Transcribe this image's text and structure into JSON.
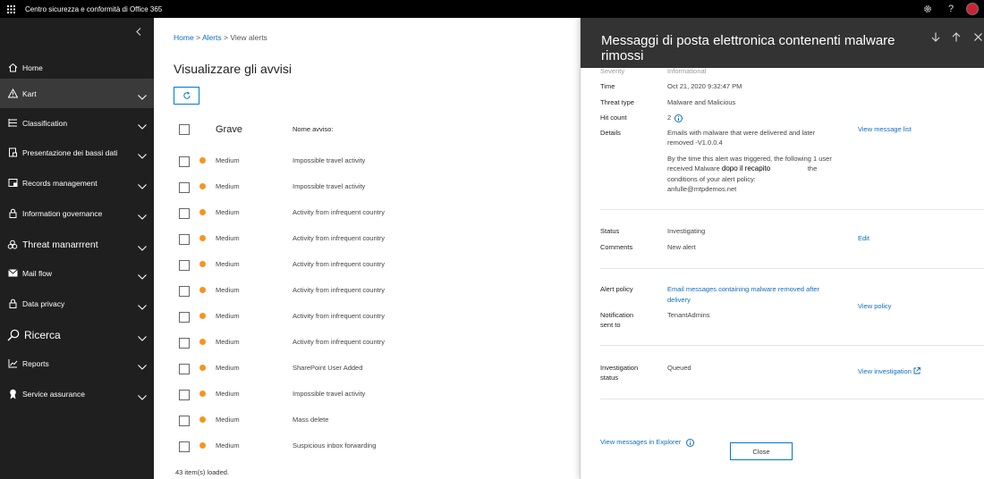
{
  "topbar": {
    "app_title": "Centro sicurezza e conformità di Office 365",
    "icons": [
      "waffle-icon",
      "settings-icon",
      "help-icon",
      "avatar"
    ],
    "help_glyph": "?"
  },
  "sidebar": {
    "items": [
      {
        "label": "Home",
        "icon": "home-icon",
        "chevron": false
      },
      {
        "label": "Kart",
        "icon": "alert-icon",
        "chevron": true,
        "active": true
      },
      {
        "label": "Classification",
        "icon": "classification-icon",
        "chevron": true
      },
      {
        "label": "Presentazione dei bassi dati",
        "icon": "data-loss-icon",
        "chevron": true
      },
      {
        "label": "Records management",
        "icon": "records-icon",
        "chevron": true
      },
      {
        "label": "Information governance",
        "icon": "lock-icon",
        "chevron": true
      },
      {
        "label": "Threat manarrrent",
        "icon": "biohazard-icon",
        "chevron": true
      },
      {
        "label": "Mail flow",
        "icon": "mail-icon",
        "chevron": true
      },
      {
        "label": "Data privacy",
        "icon": "lock-icon",
        "chevron": true
      },
      {
        "label": "Ricerca",
        "icon": "search-icon",
        "chevron": true
      },
      {
        "label": "Reports",
        "icon": "reports-icon",
        "chevron": true
      },
      {
        "label": "Service assurance",
        "icon": "ribbon-icon",
        "chevron": true
      }
    ]
  },
  "breadcrumb": {
    "home": "Home",
    "sep1": ">",
    "alerts": "Alerts",
    "sep2": ">",
    "current": "View alerts"
  },
  "page": {
    "title": "Visualizzare gli avvisi"
  },
  "table": {
    "header_severity": "Grave",
    "header_name": "Nome avviso:",
    "rows": [
      {
        "severity": "Medium",
        "name": "Impossible travel activity"
      },
      {
        "severity": "Medium",
        "name": "Impossible travel activity"
      },
      {
        "severity": "Medium",
        "name": "Activity from infrequent country"
      },
      {
        "severity": "Medium",
        "name": "Activity from infrequent country"
      },
      {
        "severity": "Medium",
        "name": "Activity from infrequent country"
      },
      {
        "severity": "Medium",
        "name": "Activity from infrequent country"
      },
      {
        "severity": "Medium",
        "name": "Activity from infrequent country"
      },
      {
        "severity": "Medium",
        "name": "Activity from infrequent country"
      },
      {
        "severity": "Medium",
        "name": "SharePoint User Added"
      },
      {
        "severity": "Medium",
        "name": "Impossible travel activity"
      },
      {
        "severity": "Medium",
        "name": "Mass delete"
      },
      {
        "severity": "Medium",
        "name": "Suspicious inbox forwarding"
      }
    ],
    "status": "43 item(s) loaded."
  },
  "panel": {
    "title": "Messaggi di posta elettronica contenenti malware rimossi",
    "partial_top": {
      "label": "Severity",
      "value": "Informational"
    },
    "time": {
      "label": "Time",
      "value": "Oct 21, 2020 9:32:47 PM"
    },
    "threat_type": {
      "label": "Threat type",
      "value": "Malware and Malicious"
    },
    "hit_count": {
      "label": "Hit count",
      "value": "2"
    },
    "details": {
      "label": "Details",
      "line1": "Emails with malware that were delivered and later",
      "line2": "removed -V1.0.0.4",
      "para_line1": "By the time this alert was triggered, the following 1 user",
      "para_line2a": "received Malware",
      "para_overlay": "dopo il recapito",
      "para_line2b": "the",
      "para_line3": "conditions of your alert policy:",
      "para_line4": "anfulle@mtpdemos.net",
      "link": "View message list"
    },
    "status": {
      "label": "Status",
      "value": "Investigating"
    },
    "comments": {
      "label": "Comments",
      "value": "New alert",
      "link": "Edit"
    },
    "alert_policy": {
      "label": "Alert policy",
      "value_line1": "Email messages containing malware removed after",
      "value_line2": "delivery",
      "link": "View policy"
    },
    "notification": {
      "label_line1": "Notification",
      "label_line2": "sent to",
      "value": "TenantAdmins"
    },
    "investigation": {
      "label_line1": "Investigation",
      "label_line2": "status",
      "value": "Queued",
      "link": "View investigation"
    },
    "explorer_link": "View messages in Explorer",
    "close_label": "Close"
  },
  "colors": {
    "sidebar_bg": "#1f1f1f",
    "topbar_bg": "#000000",
    "accent": "#0078d4",
    "link": "#106ebe",
    "severity_medium": "#f7941d",
    "panel_header": "#333333"
  }
}
